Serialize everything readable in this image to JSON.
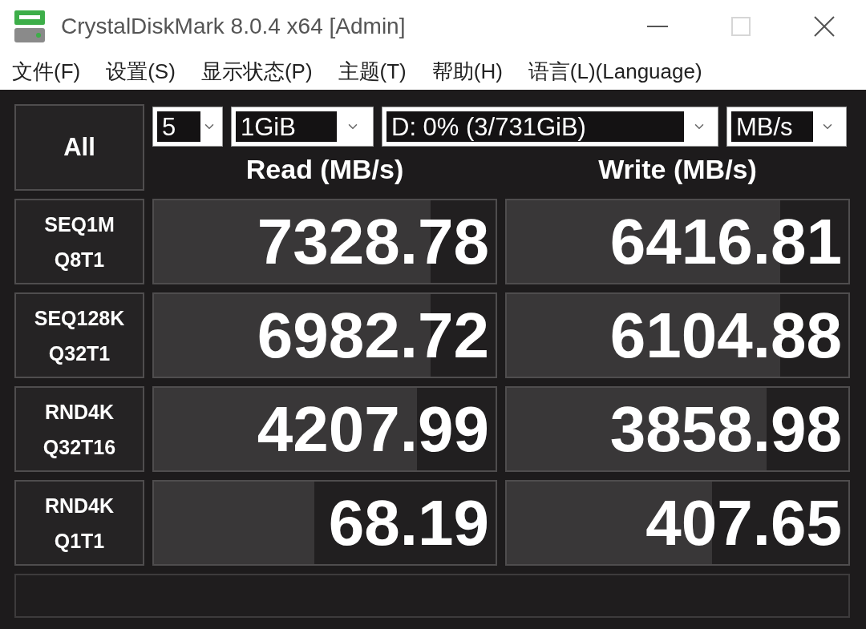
{
  "window": {
    "title": "CrystalDiskMark 8.0.4 x64 [Admin]",
    "controls": [
      {
        "kind": "minimize",
        "disabled": false
      },
      {
        "kind": "maximize",
        "disabled": true
      },
      {
        "kind": "close",
        "disabled": false
      }
    ]
  },
  "menu": [
    "文件(F)",
    "设置(S)",
    "显示状态(P)",
    "主题(T)",
    "帮助(H)",
    "语言(L)(Language)"
  ],
  "all_button": "All",
  "selectors": [
    {
      "value": "5"
    },
    {
      "value": "1GiB"
    },
    {
      "value": "D: 0% (3/731GiB)"
    },
    {
      "value": "MB/s"
    }
  ],
  "columns": [
    "Read (MB/s)",
    "Write (MB/s)"
  ],
  "tests": [
    {
      "label": [
        "SEQ1M",
        "Q8T1"
      ],
      "read": {
        "reading": "7328.78",
        "level": 0.81
      },
      "write": {
        "reading": "6416.81",
        "level": 0.8
      }
    },
    {
      "label": [
        "SEQ128K",
        "Q32T1"
      ],
      "read": {
        "reading": "6982.72",
        "level": 0.81
      },
      "write": {
        "reading": "6104.88",
        "level": 0.8
      }
    },
    {
      "label": [
        "RND4K",
        "Q32T16"
      ],
      "read": {
        "reading": "4207.99",
        "level": 0.77
      },
      "write": {
        "reading": "3858.98",
        "level": 0.76
      }
    },
    {
      "label": [
        "RND4K",
        "Q1T1"
      ],
      "read": {
        "reading": "68.19",
        "level": 0.47
      },
      "write": {
        "reading": "407.65",
        "level": 0.6
      }
    }
  ]
}
